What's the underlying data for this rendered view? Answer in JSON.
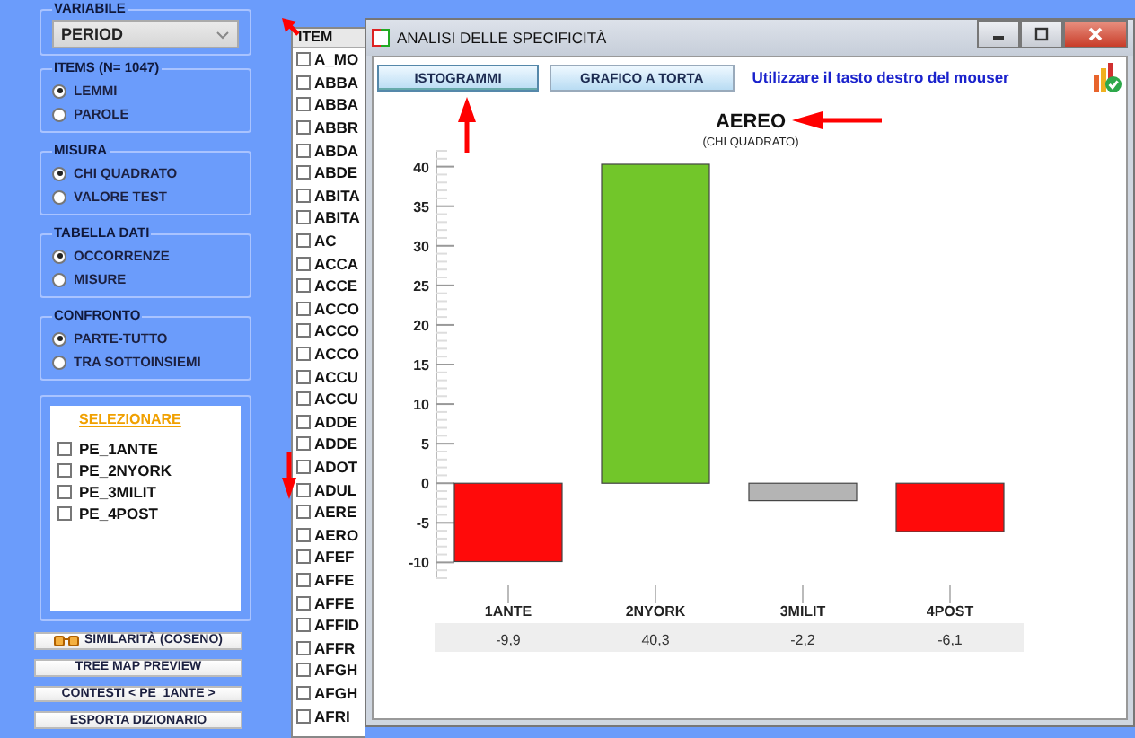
{
  "left_panel": {
    "variable_group": {
      "title": "VARIABILE",
      "dropdown": {
        "value": "PERIOD"
      }
    },
    "option_groups": [
      {
        "title": "ITEMS (N= 1047)",
        "options": [
          {
            "label": "LEMMI",
            "selected": true
          },
          {
            "label": "PAROLE",
            "selected": false
          }
        ]
      },
      {
        "title": "MISURA",
        "options": [
          {
            "label": "CHI QUADRATO",
            "selected": true
          },
          {
            "label": "VALORE TEST",
            "selected": false
          }
        ]
      },
      {
        "title": "TABELLA DATI",
        "options": [
          {
            "label": "OCCORRENZE",
            "selected": true
          },
          {
            "label": "MISURE",
            "selected": false
          }
        ]
      },
      {
        "title": "CONFRONTO",
        "options": [
          {
            "label": "PARTE-TUTTO",
            "selected": true
          },
          {
            "label": "TRA SOTTOINSIEMI",
            "selected": false
          }
        ]
      }
    ],
    "selection_list": {
      "header": "SELEZIONARE",
      "items": [
        {
          "label": "PE_1ANTE",
          "checked": false
        },
        {
          "label": "PE_2NYORK",
          "checked": false
        },
        {
          "label": "PE_3MILIT",
          "checked": false
        },
        {
          "label": "PE_4POST",
          "checked": false
        }
      ]
    },
    "buttons": [
      {
        "label": "SIMILARITÀ (COSENO)",
        "kind": "icon"
      },
      {
        "label": "TREE MAP PREVIEW",
        "kind": "plain"
      },
      {
        "label": "CONTESTI  < PE_1ANTE >",
        "kind": "plain"
      },
      {
        "label": "ESPORTA DIZIONARIO",
        "kind": "plain"
      }
    ]
  },
  "item_list": {
    "header": "ITEM",
    "items": [
      {
        "label": "A_MO",
        "checked": false
      },
      {
        "label": "ABBA",
        "checked": false
      },
      {
        "label": "ABBA",
        "checked": false
      },
      {
        "label": "ABBR",
        "checked": false
      },
      {
        "label": "ABDA",
        "checked": false
      },
      {
        "label": "ABDE",
        "checked": false
      },
      {
        "label": "ABITA",
        "checked": false
      },
      {
        "label": "ABITA",
        "checked": false
      },
      {
        "label": "AC",
        "checked": false
      },
      {
        "label": "ACCA",
        "checked": false
      },
      {
        "label": "ACCE",
        "checked": false
      },
      {
        "label": "ACCO",
        "checked": false
      },
      {
        "label": "ACCO",
        "checked": false
      },
      {
        "label": "ACCO",
        "checked": false
      },
      {
        "label": "ACCU",
        "checked": false
      },
      {
        "label": "ACCU",
        "checked": false
      },
      {
        "label": "ADDE",
        "checked": false
      },
      {
        "label": "ADDE",
        "checked": false
      },
      {
        "label": "ADOT",
        "checked": false
      },
      {
        "label": "ADUL",
        "checked": false
      },
      {
        "label": "AERE",
        "checked": false
      },
      {
        "label": "AERO",
        "checked": false
      },
      {
        "label": "AFEF",
        "checked": false
      },
      {
        "label": "AFFE",
        "checked": false
      },
      {
        "label": "AFFE",
        "checked": false
      },
      {
        "label": "AFFID",
        "checked": false
      },
      {
        "label": "AFFR",
        "checked": false
      },
      {
        "label": "AFGH",
        "checked": false
      },
      {
        "label": "AFGH",
        "checked": false
      },
      {
        "label": "AFRI",
        "checked": false
      }
    ]
  },
  "window": {
    "title": "ANALISI DELLE SPECIFICITÀ",
    "tabs": [
      {
        "label": "ISTOGRAMMI",
        "selected": true
      },
      {
        "label": "GRAFICO A TORTA",
        "selected": false
      }
    ],
    "hint": "Utilizzare il tasto destro del mouser",
    "chart": {
      "subtitle": "(CHI QUADRATO)",
      "chart_data": {
        "type": "bar",
        "title": "AEREO",
        "categories": [
          "1ANTE",
          "2NYORK",
          "3MILIT",
          "4POST"
        ],
        "values": [
          -9.9,
          40.3,
          -2.2,
          -6.1
        ],
        "ylim": [
          -12,
          42
        ],
        "yticks": [
          -10,
          -5,
          0,
          5,
          10,
          15,
          20,
          25,
          30,
          35,
          40
        ],
        "value_labels": [
          "-9,9",
          "40,3",
          "-2,2",
          "-6,1"
        ]
      }
    }
  }
}
